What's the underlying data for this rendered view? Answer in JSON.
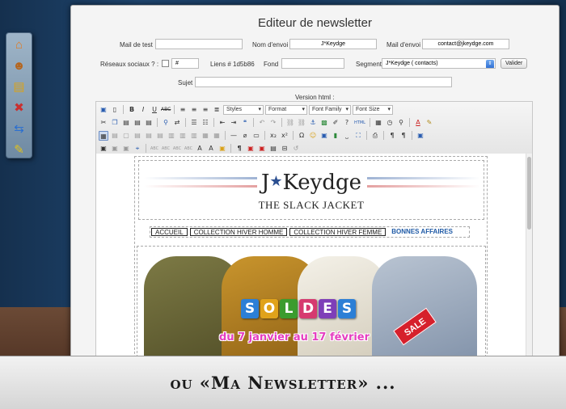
{
  "window": {
    "title": "Editeur de newsletter"
  },
  "form": {
    "mail_test_label": "Mail de test",
    "mail_test_value": "",
    "nom_envoi_label": "Nom d'envoi",
    "nom_envoi_value": "J*Keydge",
    "mail_envoi_label": "Mail d'envoi",
    "mail_envoi_value": "contact@jkeydge.com",
    "reseaux_label": "Réseaux sociaux ? :",
    "reseaux_hash": "#",
    "liens_label": "Liens # 1d5b86",
    "fond_label": "Fond",
    "fond_value": "",
    "segment_label": "Segment",
    "segment_value": "J*Keydge (        contacts)",
    "valider_label": "Valider",
    "sujet_label": "Sujet",
    "sujet_value": "",
    "version_html_label": "Version html :"
  },
  "toolbar": {
    "styles": "Styles",
    "format": "Format",
    "font_family": "Font Family",
    "font_size": "Font Size",
    "html_button": "HTML"
  },
  "newsletter": {
    "brand": "J",
    "brand_rest": "Keydge",
    "tagline": "THE SLACK JACKET",
    "nav": [
      "ACCUEIL",
      "COLLECTION HIVER HOMME",
      "COLLECTION HIVER FEMME",
      "BONNES AFFAIRES"
    ],
    "soldes_letters": [
      "S",
      "O",
      "L",
      "D",
      "E",
      "S"
    ],
    "soldes_colors": [
      "#2c7fd6",
      "#e0a21b",
      "#3b9c2e",
      "#d63a6f",
      "#7e3fb8",
      "#2c7fd6"
    ],
    "dates": "du 7 janvier au 17 février",
    "sale": "SALE"
  },
  "caption": "ou «Ma Newsletter» ...",
  "dock": {
    "icons": [
      "home-icon",
      "users-icon",
      "document-add-icon",
      "document-delete-icon",
      "refresh-icon",
      "pencil-icon"
    ]
  }
}
